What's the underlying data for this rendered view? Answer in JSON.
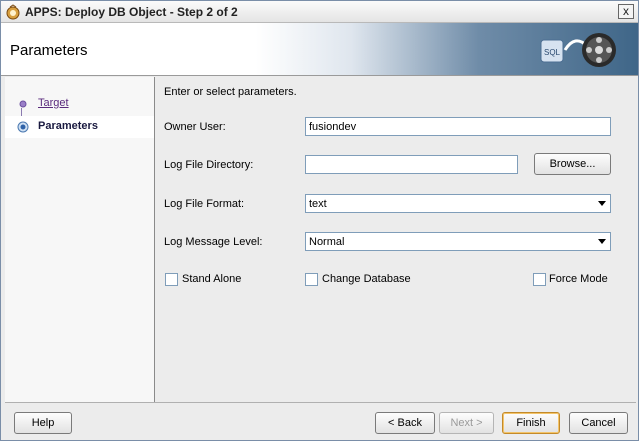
{
  "window": {
    "title": "APPS: Deploy DB Object - Step 2 of 2",
    "close_label": "x"
  },
  "header": {
    "title": "Parameters"
  },
  "nav": {
    "items": [
      {
        "label": "Target",
        "state": "visited"
      },
      {
        "label": "Parameters",
        "state": "current"
      }
    ]
  },
  "main": {
    "hint": "Enter or select parameters.",
    "owner_user": {
      "label": "Owner User:",
      "value": "fusiondev"
    },
    "log_file_directory": {
      "label": "Log File Directory:",
      "value": "",
      "browse_label": "Browse..."
    },
    "log_file_format": {
      "label": "Log File Format:",
      "value": "text"
    },
    "log_message_level": {
      "label": "Log Message Level:",
      "value": "Normal"
    },
    "checkboxes": {
      "stand_alone": {
        "label": "Stand Alone",
        "checked": false
      },
      "change_database": {
        "label": "Change Database",
        "checked": false
      },
      "force_mode": {
        "label": "Force Mode",
        "checked": false
      }
    }
  },
  "footer": {
    "help": "Help",
    "back": "< Back",
    "next": "Next >",
    "finish": "Finish",
    "cancel": "Cancel"
  }
}
